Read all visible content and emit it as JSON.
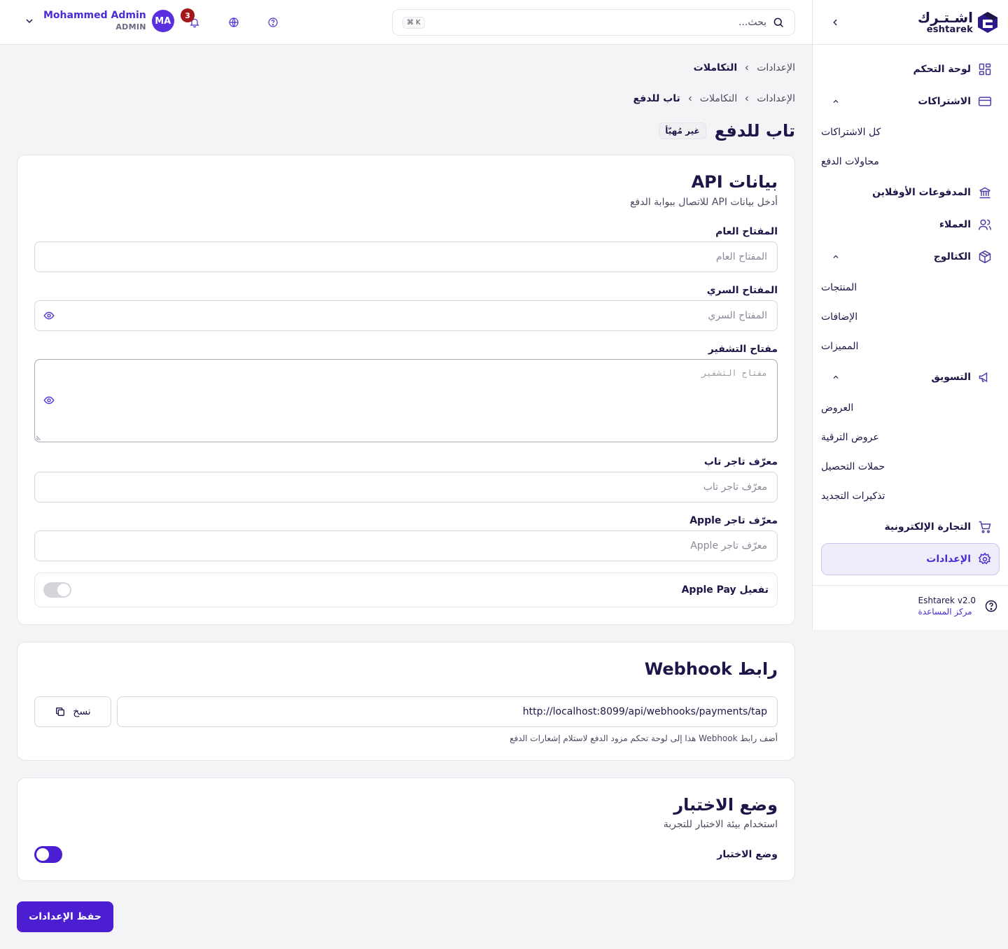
{
  "brand": {
    "name_ar": "اشـتـرك",
    "name_en": "eshtarek"
  },
  "topbar": {
    "search_placeholder": "بحث...",
    "search_shortcut": "⌘ K",
    "notifications_count": "3",
    "user": {
      "name": "Mohammed Admin",
      "role": "ADMIN",
      "initials": "MA"
    }
  },
  "sidebar": {
    "items": [
      {
        "label": "لوحة التحكم",
        "icon": "dashboard-icon"
      },
      {
        "label": "الاشتراكات",
        "icon": "credit-card-icon",
        "children": [
          "كل الاشتراكات",
          "محاولات الدفع"
        ]
      },
      {
        "label": "المدفوعات الأوفلاين",
        "icon": "bank-icon"
      },
      {
        "label": "العملاء",
        "icon": "users-icon"
      },
      {
        "label": "الكتالوج",
        "icon": "package-icon",
        "children": [
          "المنتجات",
          "الإضافات",
          "المميزات"
        ]
      },
      {
        "label": "التسويق",
        "icon": "megaphone-icon",
        "children": [
          "العروض",
          "عروض الترقية",
          "حملات التحصيل",
          "تذكيرات التجديد"
        ]
      },
      {
        "label": "التجارة الإلكترونية",
        "icon": "cart-icon"
      },
      {
        "label": "الإعدادات",
        "icon": "gear-icon",
        "active": true
      }
    ],
    "footer": {
      "version": "Eshtarek v2.0",
      "help_link": "مركز المساعدة"
    }
  },
  "breadcrumbs": {
    "first": [
      "الإعدادات",
      "التكاملات"
    ],
    "second": [
      "الإعدادات",
      "التكاملات",
      "تاب للدفع"
    ]
  },
  "page": {
    "title": "تاب للدفع",
    "status_badge": "غير مُهيّأ"
  },
  "api_card": {
    "title": "بيانات API",
    "subtitle": "أدخل بيانات API للاتصال ببوابة الدفع",
    "fields": {
      "public_key": {
        "label": "المفتاح العام",
        "placeholder": "المفتاح العام"
      },
      "secret_key": {
        "label": "المفتاح السري",
        "placeholder": "المفتاح السري"
      },
      "encryption_key": {
        "label": "مفتاح التشفير",
        "placeholder": "مفتاح التشفير"
      },
      "tap_merchant_id": {
        "label": "معرّف تاجر تاب",
        "placeholder": "معرّف تاجر تاب"
      },
      "apple_merchant_id": {
        "label": "معرّف تاجر Apple",
        "placeholder": "معرّف تاجر Apple"
      }
    },
    "apple_pay_toggle": {
      "label": "تفعيل Apple Pay",
      "on": false
    }
  },
  "webhook_card": {
    "title": "رابط Webhook",
    "url": "http://localhost:8099/api/webhooks/payments/tap",
    "copy_label": "نسخ",
    "hint": "أضف رابط Webhook هذا إلى لوحة تحكم مزود الدفع لاستلام إشعارات الدفع"
  },
  "test_card": {
    "title": "وضع الاختبار",
    "subtitle": "استخدام بيئة الاختبار للتجربة",
    "toggle_label": "وضع الاختبار",
    "on": true
  },
  "save_button": "حفظ الإعدادات",
  "colors": {
    "primary": "#4b1fd1",
    "accent": "#5b2ee0",
    "text": "#1e1548",
    "badge": "#a3161a"
  }
}
